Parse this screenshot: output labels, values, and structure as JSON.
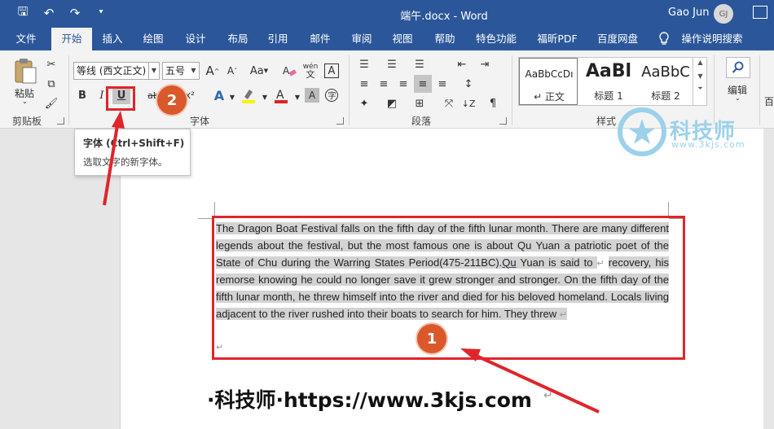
{
  "titlebar": {
    "doc_title": "端午.docx  -  Word",
    "user_name": "Gao Jun",
    "avatar_initials": "GJ",
    "qat_save": "🖫",
    "qat_undo": "↶",
    "qat_redo": "↷",
    "qat_customize": "⯆"
  },
  "tabs": [
    "文件",
    "开始",
    "插入",
    "绘图",
    "设计",
    "布局",
    "引用",
    "邮件",
    "审阅",
    "视图",
    "帮助",
    "特色功能",
    "福昕PDF",
    "百度网盘",
    "操作说明搜索"
  ],
  "active_tab": "开始",
  "ribbon": {
    "clipboard": {
      "paste_label": "粘贴",
      "group_label": "剪贴板"
    },
    "font": {
      "font_name": "等线 (西文正文)",
      "font_size": "五号",
      "group_label": "字体",
      "bold": "B",
      "italic": "I",
      "underline": "U",
      "strike": "abc",
      "superscript": "x²",
      "grow": "A",
      "shrink": "A",
      "case": "Aa",
      "pinyin": "wén",
      "border_char": "A"
    },
    "paragraph": {
      "group_label": "段落"
    },
    "styles": {
      "group_label": "样式",
      "items": [
        {
          "sample": "AaBbCcDı",
          "name": "↵ 正文"
        },
        {
          "sample": "AaBl",
          "name": "标题 1"
        },
        {
          "sample": "AaBbC",
          "name": "标题 2"
        }
      ]
    },
    "editing": {
      "label": "编辑",
      "extra": "百"
    }
  },
  "tooltip": {
    "title": "字体 (Ctrl+Shift+F)",
    "description": "选取文字的新字体。"
  },
  "document": {
    "body_text": "The Dragon Boat Festival falls on the fifth day of the fifth lunar month. There are many different legends about the festival, but the most famous one is about Qu Yuan a patriotic poet of the State of Chu during the Warring States Period(475-211BC).",
    "body_text_underlined": "Qu",
    "body_text_rest": " Yuan is said to ",
    "body_text_2": "recovery, his remorse knowing he could no longer save it grew stronger and stronger. On the fifth day of the fifth lunar month, he threw himself into the river and died for his beloved homeland. Locals living adjacent to the river rushed into their boats to search for him. They threw ",
    "para_mark": "↵",
    "website_text": "·科技师·https://www.3kjs.com"
  },
  "annotations": {
    "badge_1": "1",
    "badge_2": "2",
    "red": "#e0252b",
    "badge_color": "#d9582c"
  },
  "watermark": {
    "text": "科技师",
    "url": "www.3kjs.com"
  },
  "colors": {
    "ribbon_blue": "#2b579a",
    "selection": "#d3d3d3"
  }
}
